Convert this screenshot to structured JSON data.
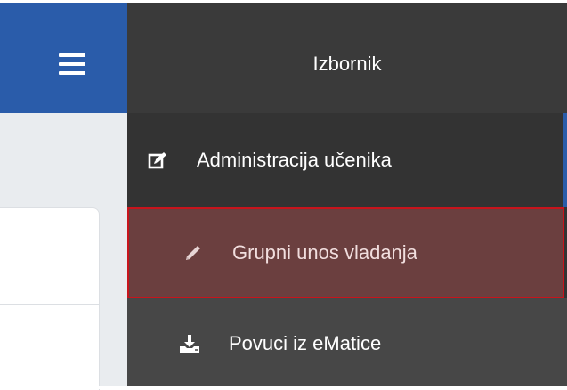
{
  "header": {
    "menu_title": "Izbornik"
  },
  "menu": {
    "items": [
      {
        "label": "Administracija učenika",
        "icon": "edit-square-icon"
      },
      {
        "label": "Grupni unos vladanja",
        "icon": "pencil-icon"
      },
      {
        "label": "Povuci iz eMatice",
        "icon": "download-icon"
      }
    ]
  },
  "colors": {
    "brand_blue": "#2a5caa",
    "menu_bg": "#333333",
    "selected_bg": "#6b3f3f",
    "selected_border": "#c8141c"
  }
}
